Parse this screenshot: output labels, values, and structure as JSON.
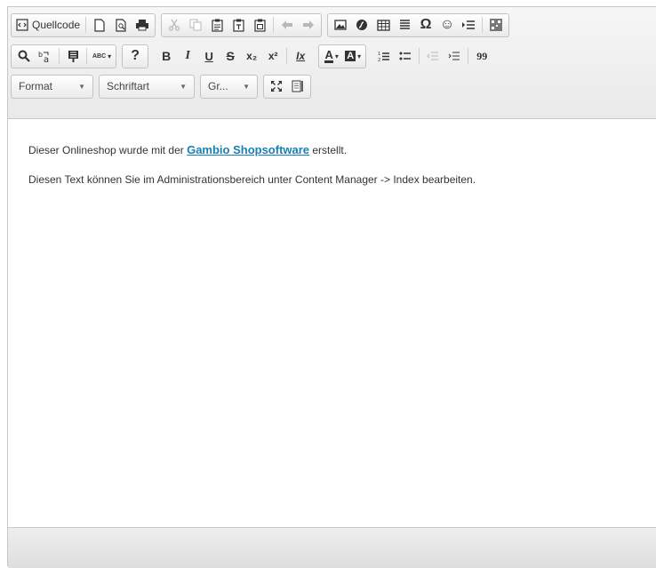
{
  "toolbar": {
    "source_label": "Quellcode",
    "format": {
      "value": "Format"
    },
    "font": {
      "value": "Schriftart"
    },
    "size": {
      "value": "Gr..."
    },
    "text_glyphs": {
      "help": "?",
      "bold": "B",
      "italic": "I",
      "underline": "U",
      "strike": "S",
      "subscript": "x₂",
      "superscript": "x²",
      "remove_format": "Ix",
      "text_color": "A",
      "bg_color": "A",
      "blockquote": "99",
      "special_char": "Ω",
      "smiley": "☺",
      "spellcheck": "ABC"
    }
  },
  "content": {
    "line1_before": "Dieser Onlineshop wurde mit der ",
    "line1_link": "Gambio Shopsoftware",
    "line1_after": " erstellt.",
    "line2": "Diesen Text können Sie im Administrationsbereich unter Content Manager -> Index bearbeiten."
  },
  "colors": {
    "link": "#1a80b6",
    "text": "#333333",
    "toolbar_bg": "#f0f0f0",
    "disabled_icon": "#b8b8b8"
  }
}
